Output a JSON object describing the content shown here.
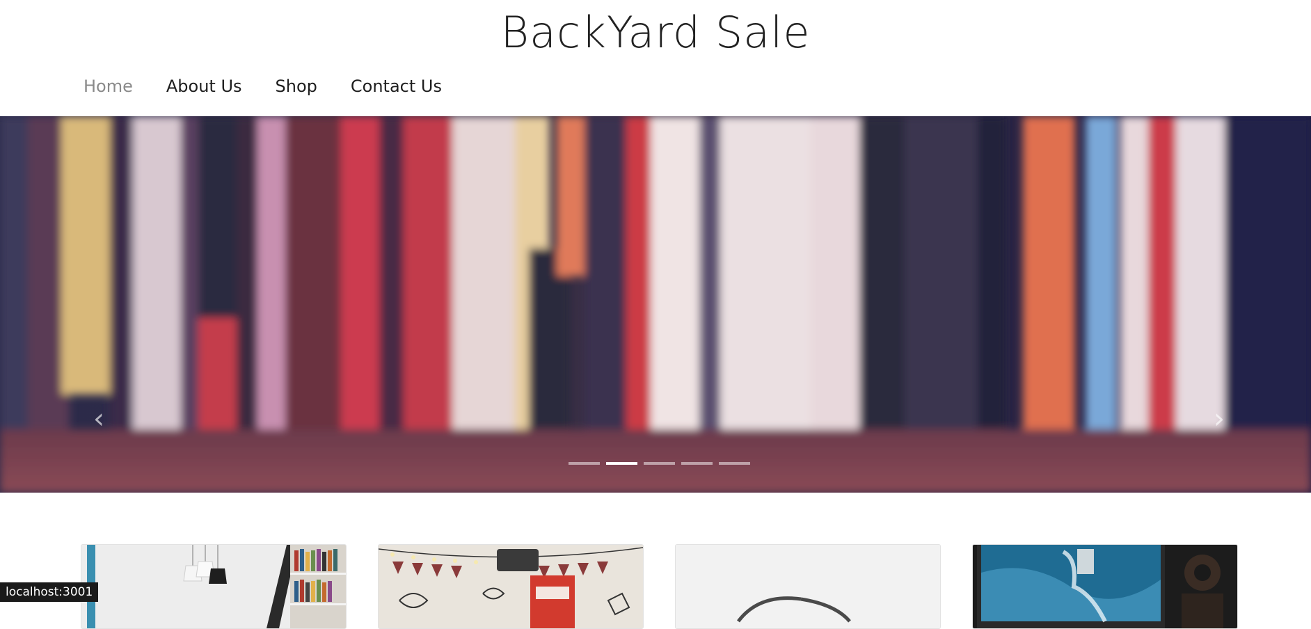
{
  "site": {
    "title": "BackYard Sale"
  },
  "nav": {
    "items": [
      {
        "label": "Home",
        "active": true
      },
      {
        "label": "About Us",
        "active": false
      },
      {
        "label": "Shop",
        "active": false
      },
      {
        "label": "Contact Us",
        "active": false
      }
    ]
  },
  "carousel": {
    "slide_count": 5,
    "active_index": 1,
    "prev_icon": "chevron-left-icon",
    "next_icon": "chevron-right-icon"
  },
  "cards": {
    "count": 4
  },
  "status_bar": {
    "url": "localhost:3001"
  },
  "colors": {
    "nav_active": "#8a8a8a",
    "nav_text": "#1e1e1e",
    "carousel_backdrop": "#1b1a3a"
  }
}
